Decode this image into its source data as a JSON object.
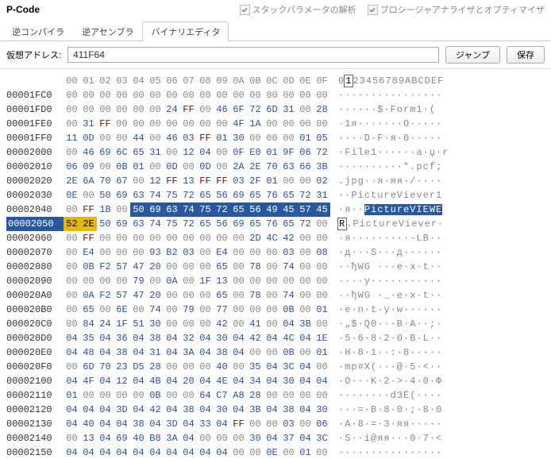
{
  "title": "P-Code",
  "options": {
    "opt1": "スタックパラメータの解析",
    "opt2": "プロシージャアナライザとオプティマイザ"
  },
  "tabs": [
    "逆コンパイラ",
    "逆アセンブラ",
    "バイナリエディタ"
  ],
  "active_tab": 2,
  "addr_label": "仮想アドレス:",
  "addr_value": "411F64",
  "jump_label": "ジャンプ",
  "save_label": "保存",
  "hex_cols": [
    "00",
    "01",
    "02",
    "03",
    "04",
    "05",
    "06",
    "07",
    "08",
    "09",
    "0A",
    "0B",
    "0C",
    "0D",
    "0E",
    "0F"
  ],
  "ascii_header": "0123456789ABCDEF",
  "rows": [
    {
      "o": "00001FC0",
      "b": [
        "00",
        "00",
        "00",
        "00",
        "00",
        "00",
        "00",
        "00",
        "00",
        "00",
        "00",
        "00",
        "00",
        "00",
        "00",
        "00"
      ],
      "a": "················"
    },
    {
      "o": "00001FD0",
      "b": [
        "00",
        "00",
        "00",
        "00",
        "00",
        "00",
        "24",
        "FF",
        "00",
        "46",
        "6F",
        "72",
        "6D",
        "31",
        "00",
        "28"
      ],
      "a": "······$·Form1·("
    },
    {
      "o": "00001FE0",
      "b": [
        "00",
        "31",
        "FF",
        "00",
        "00",
        "00",
        "00",
        "00",
        "00",
        "00",
        "4F",
        "1A",
        "00",
        "00",
        "00",
        "00"
      ],
      "a": "·1я·······O·····"
    },
    {
      "o": "00001FF0",
      "b": [
        "11",
        "0D",
        "00",
        "00",
        "44",
        "00",
        "46",
        "03",
        "FF",
        "01",
        "30",
        "00",
        "00",
        "00",
        "01",
        "05"
      ],
      "a": "····D·F·я·0·····"
    },
    {
      "o": "00002000",
      "b": [
        "00",
        "46",
        "69",
        "6C",
        "65",
        "31",
        "00",
        "12",
        "04",
        "00",
        "0F",
        "E0",
        "01",
        "9F",
        "06",
        "72"
      ],
      "a": "·File1······а·џ·r"
    },
    {
      "o": "00002010",
      "b": [
        "06",
        "09",
        "00",
        "0B",
        "01",
        "00",
        "0D",
        "00",
        "0D",
        "00",
        "2A",
        "2E",
        "70",
        "63",
        "66",
        "3B"
      ],
      "a": "··········*.pcf;"
    },
    {
      "o": "00002020",
      "b": [
        "2E",
        "6A",
        "70",
        "67",
        "00",
        "12",
        "FF",
        "13",
        "FF",
        "FF",
        "03",
        "2F",
        "01",
        "00",
        "00",
        "02"
      ],
      "a": ".jpg··я·яя·/····"
    },
    {
      "o": "00002030",
      "b": [
        "0E",
        "00",
        "50",
        "69",
        "63",
        "74",
        "75",
        "72",
        "65",
        "56",
        "69",
        "65",
        "76",
        "65",
        "72",
        "31"
      ],
      "a": "··PictureViever1"
    },
    {
      "o": "00002040",
      "b": [
        "00",
        "FF",
        "1B",
        "00",
        "50",
        "69",
        "63",
        "74",
        "75",
        "72",
        "65",
        "56",
        "49",
        "45",
        "57",
        "45"
      ],
      "a": "·я··PictureVIEWE",
      "hi": [
        4,
        5,
        6,
        7,
        8,
        9,
        10,
        11,
        12,
        13,
        14,
        15
      ],
      "ahi": [
        4,
        16
      ]
    },
    {
      "o": "00002050",
      "b": [
        "52",
        "2E",
        "50",
        "69",
        "63",
        "74",
        "75",
        "72",
        "65",
        "56",
        "69",
        "65",
        "76",
        "65",
        "72",
        "00"
      ],
      "a": "R.PictureViever·",
      "sel": true,
      "bsel": [
        0,
        1
      ],
      "acursor": 0
    },
    {
      "o": "00002060",
      "b": [
        "00",
        "FF",
        "00",
        "00",
        "00",
        "00",
        "00",
        "00",
        "00",
        "00",
        "00",
        "2D",
        "4C",
        "42",
        "00",
        "00"
      ],
      "a": "·я·········-LB··"
    },
    {
      "o": "00002070",
      "b": [
        "00",
        "E4",
        "00",
        "00",
        "00",
        "93",
        "B2",
        "03",
        "00",
        "E4",
        "00",
        "00",
        "00",
        "03",
        "00",
        "08"
      ],
      "a": "·д···Ѕ···д······"
    },
    {
      "o": "00002080",
      "b": [
        "00",
        "0B",
        "F2",
        "57",
        "47",
        "20",
        "00",
        "00",
        "00",
        "65",
        "00",
        "78",
        "00",
        "74",
        "00",
        "00"
      ],
      "a": "··ђWG ···e·x·t··"
    },
    {
      "o": "00002090",
      "b": [
        "00",
        "00",
        "00",
        "00",
        "79",
        "00",
        "0A",
        "00",
        "1F",
        "13",
        "00",
        "00",
        "00",
        "00",
        "00",
        "00"
      ],
      "a": "····y···········"
    },
    {
      "o": "000020A0",
      "b": [
        "00",
        "0A",
        "F2",
        "57",
        "47",
        "20",
        "00",
        "00",
        "00",
        "65",
        "00",
        "78",
        "00",
        "74",
        "00",
        "00"
      ],
      "a": "··ђWG ·_·e·x·t··"
    },
    {
      "o": "000020B0",
      "b": [
        "00",
        "65",
        "00",
        "6E",
        "00",
        "74",
        "00",
        "79",
        "00",
        "77",
        "00",
        "00",
        "00",
        "0B",
        "00",
        "01"
      ],
      "a": "·e·n·t·y·w······"
    },
    {
      "o": "000020C0",
      "b": [
        "00",
        "84",
        "24",
        "1F",
        "51",
        "30",
        "00",
        "00",
        "00",
        "42",
        "00",
        "41",
        "00",
        "04",
        "3B",
        "00"
      ],
      "a": "·„$·Q0···B·A··;·"
    },
    {
      "o": "000020D0",
      "b": [
        "04",
        "35",
        "04",
        "36",
        "04",
        "38",
        "04",
        "32",
        "04",
        "30",
        "04",
        "42",
        "04",
        "4C",
        "04",
        "1E"
      ],
      "a": "·5·6·8·2·0·B·L··"
    },
    {
      "o": "000020E0",
      "b": [
        "04",
        "48",
        "04",
        "38",
        "04",
        "31",
        "04",
        "3A",
        "04",
        "38",
        "04",
        "00",
        "00",
        "0B",
        "00",
        "01"
      ],
      "a": "·H·8·1··:·8·····"
    },
    {
      "o": "000020F0",
      "b": [
        "00",
        "6D",
        "70",
        "23",
        "D5",
        "28",
        "00",
        "00",
        "00",
        "40",
        "00",
        "35",
        "04",
        "3C",
        "04",
        "00"
      ],
      "a": "·mp#Х(···@·5·<··"
    },
    {
      "o": "00002100",
      "b": [
        "04",
        "4F",
        "04",
        "12",
        "04",
        "4B",
        "04",
        "20",
        "04",
        "4E",
        "04",
        "34",
        "04",
        "30",
        "04",
        "04"
      ],
      "a": "·O···K·2·>·4·0·Ф"
    },
    {
      "o": "00002110",
      "b": [
        "01",
        "00",
        "00",
        "00",
        "00",
        "0B",
        "00",
        "00",
        "64",
        "C7",
        "A8",
        "28",
        "00",
        "00",
        "00",
        "00"
      ],
      "a": "········dЗЁ(····"
    },
    {
      "o": "00002120",
      "b": [
        "04",
        "04",
        "04",
        "3D",
        "04",
        "42",
        "04",
        "38",
        "04",
        "30",
        "04",
        "3B",
        "04",
        "38",
        "04",
        "30"
      ],
      "a": "···=·B·8·0·;·8·0"
    },
    {
      "o": "00002130",
      "b": [
        "04",
        "40",
        "04",
        "04",
        "38",
        "04",
        "3D",
        "04",
        "33",
        "04",
        "FF",
        "00",
        "00",
        "03",
        "00",
        "06"
      ],
      "a": "·A·8·=·3·яя·····"
    },
    {
      "o": "00002140",
      "b": [
        "00",
        "13",
        "04",
        "69",
        "40",
        "B8",
        "3A",
        "04",
        "00",
        "00",
        "00",
        "30",
        "04",
        "37",
        "04",
        "3C"
      ],
      "a": "·Ѕ··i@яя···0·7·<"
    },
    {
      "o": "00002150",
      "b": [
        "04",
        "04",
        "04",
        "04",
        "04",
        "04",
        "04",
        "04",
        "04",
        "04",
        "00",
        "00",
        "0E",
        "00",
        "01",
        "00"
      ],
      "a": "················"
    }
  ]
}
